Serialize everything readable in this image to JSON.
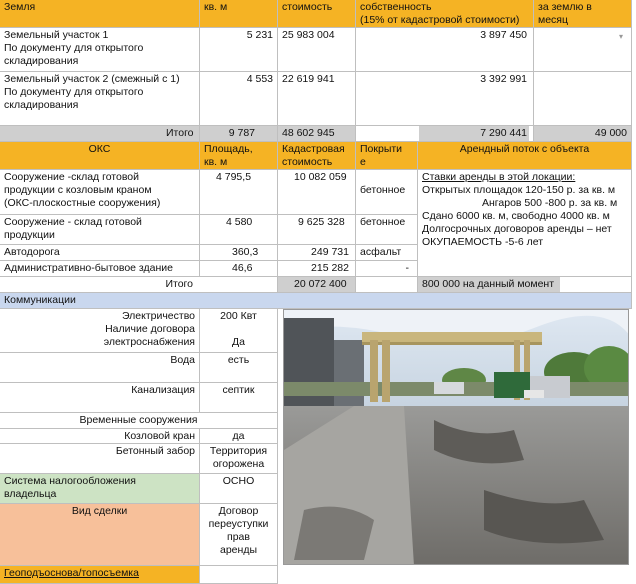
{
  "header1": {
    "land": "Земля",
    "sqm": "кв. м",
    "cost": "стоимость",
    "ownership": "собственность\n(15% от кадастровой стоимости)",
    "monthly": "за землю в\nмесяц"
  },
  "land_rows": [
    {
      "name": "Земельный участок 1\nПо документу для открытого\nскладирования",
      "sqm": "5 231",
      "cost": "25 983 004",
      "value": "3 897 450"
    },
    {
      "name": "Земельный участок 2 (смежный с 1)\nПо документу для открытого\nскладирования",
      "sqm": "4 553",
      "cost": "22 619 941",
      "value": "3 392 991"
    }
  ],
  "land_total": {
    "label": "Итого",
    "sqm": "9 787",
    "cost": "48 602 945",
    "value": "7 290 441",
    "monthly": "49 000"
  },
  "header2": {
    "oks": "ОКС",
    "area": "Площадь,\nкв. м",
    "cad_cost": "Кадастровая\nстоимость",
    "cover": "Покрыти\nе",
    "rent_flow": "Арендный поток с объекта"
  },
  "oks_rows": [
    {
      "name": "Сооружение -склад готовой\nпродукции с козловым краном\n(ОКС-плоскостные сооружения)",
      "area": "4 795,5",
      "cost": "10 082 059",
      "cover": "бетонное"
    },
    {
      "name": "Сооружение - склад готовой\nпродукции",
      "area": "4 580",
      "cost": "9 625 328",
      "cover": "бетонное"
    },
    {
      "name": "Автодорога",
      "area": "360,3",
      "cost": "249 731",
      "cover": "асфальт"
    },
    {
      "name": "Административно-бытовое здание",
      "area": "46,6",
      "cost": "215 282",
      "cover": "-"
    }
  ],
  "rent_info": {
    "title": "Ставки аренды в этой локации:",
    "line1": "Открытых площадок 120-150 р. за кв. м",
    "line2": "Ангаров 500 -800 р. за кв. м",
    "line3": "Сдано 6000 кв. м, свободно 4000 кв. м",
    "line4": "Долгосрочных договоров аренды – нет",
    "line5": "ОКУПАЕМОСТЬ -5-6 лет"
  },
  "oks_total": {
    "label": "Итого",
    "cost": "20 072 400",
    "rent": "800 000 на данный момент"
  },
  "communications": {
    "title": "Коммуникации",
    "electricity_label": "Электричество\nНаличие договора\nэлектроснабжения",
    "electricity_value": "200 Квт\n\nДа",
    "water_label": "Вода",
    "water_value": "есть",
    "sewer_label": "Канализация",
    "sewer_value": "септик"
  },
  "temporary": {
    "title": "Временные сооружения",
    "crane_label": "Козловой кран",
    "crane_value": "да",
    "fence_label": "Бетонный забор",
    "fence_value": "Территория\nогорожена"
  },
  "tax": {
    "label": "Система налогообложения\nвладельца",
    "value": "ОСНО"
  },
  "deal": {
    "label": "Вид сделки",
    "value": "Договор\nпереуступки\nправ\nаренды"
  },
  "geo": {
    "label": "Геоподъоснова/топосъемка"
  },
  "colors": {
    "orange": "#f5b324",
    "gray": "#cfcfcf",
    "blue": "#c9d7ee",
    "green": "#cde3c4",
    "salmon": "#f7c09a"
  }
}
